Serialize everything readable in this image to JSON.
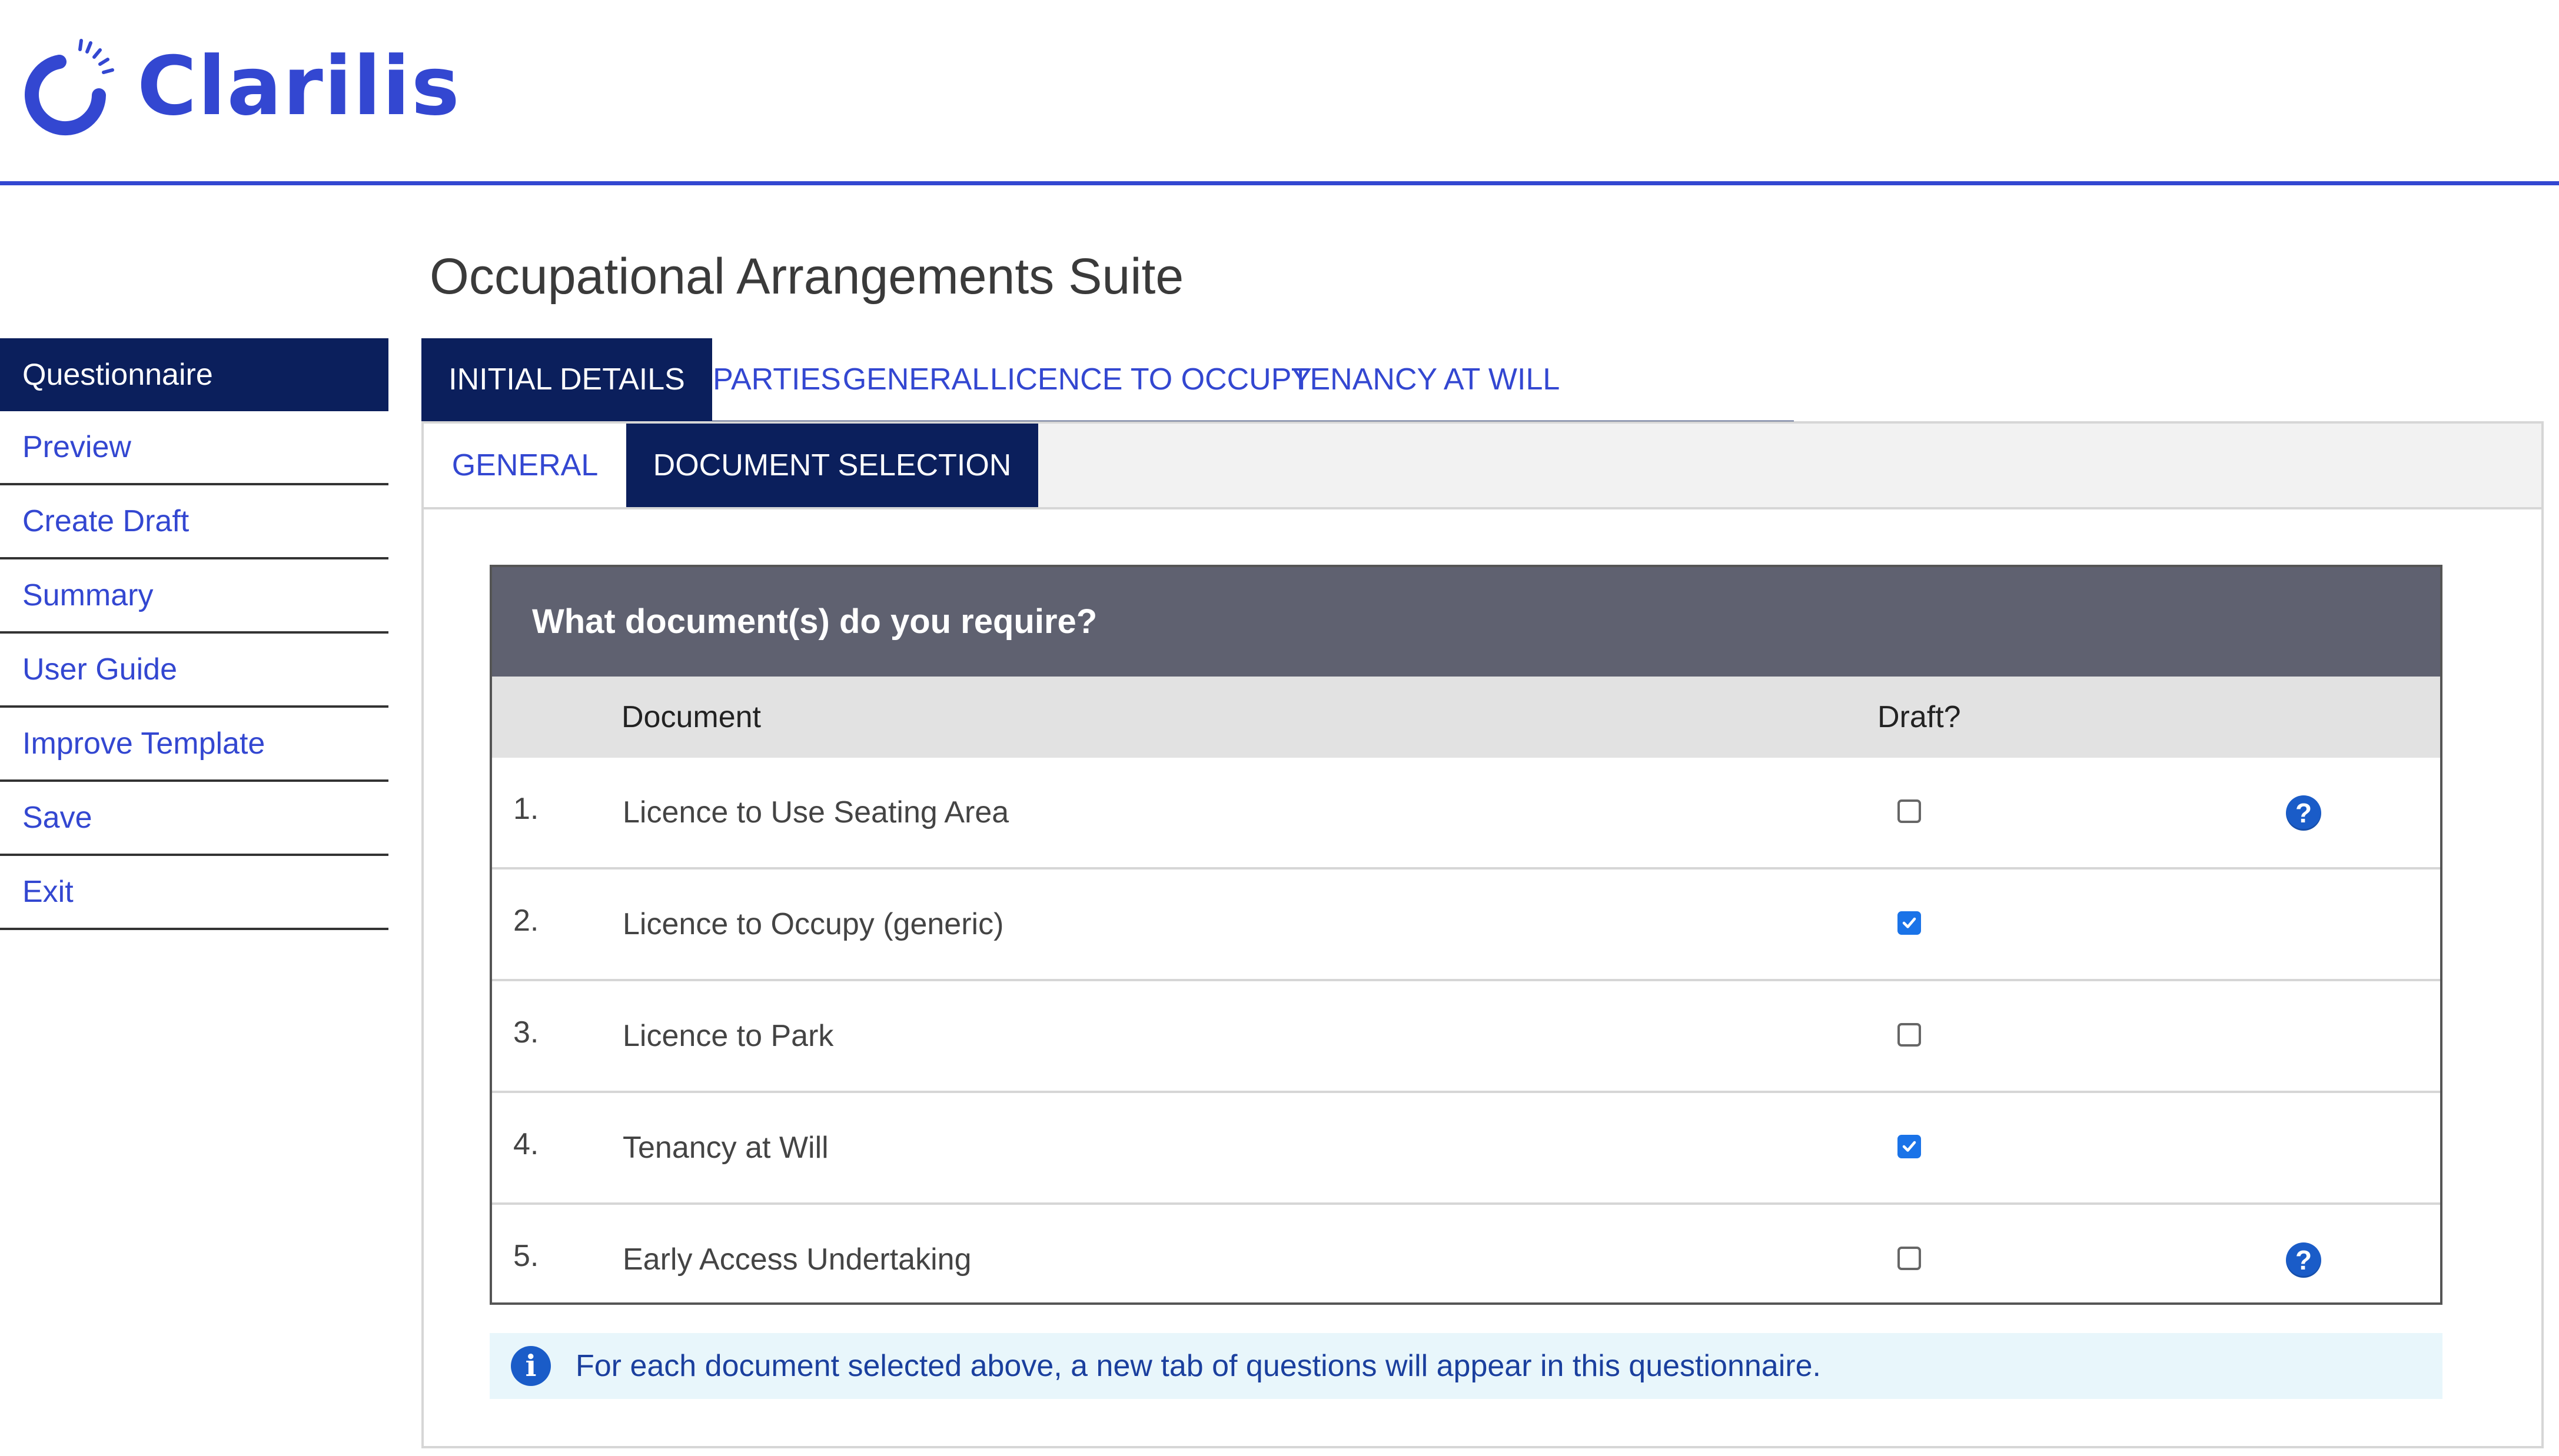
{
  "app": {
    "brand": "Clarilis",
    "brand_color": "#3347d1",
    "nav_active_color": "#0b1f5c"
  },
  "page_title": "Occupational Arrangements Suite",
  "sidebar": {
    "items": [
      {
        "label": "Questionnaire",
        "active": true
      },
      {
        "label": "Preview"
      },
      {
        "label": "Create Draft"
      },
      {
        "label": "Summary"
      },
      {
        "label": "User Guide"
      },
      {
        "label": "Improve Template"
      },
      {
        "label": "Save"
      },
      {
        "label": "Exit"
      }
    ]
  },
  "tabs": [
    {
      "label": "INITIAL DETAILS",
      "active": true
    },
    {
      "label": "PARTIES"
    },
    {
      "label": "GENERAL"
    },
    {
      "label": "LICENCE TO OCCUPY"
    },
    {
      "label": "TENANCY AT WILL"
    }
  ],
  "subtabs": [
    {
      "label": "GENERAL"
    },
    {
      "label": "DOCUMENT SELECTION",
      "active": true
    }
  ],
  "question": {
    "title": "What document(s) do you require?",
    "columns": {
      "document": "Document",
      "draft": "Draft?"
    },
    "rows": [
      {
        "num": "1.",
        "label": "Licence to Use Seating Area",
        "checked": false,
        "help": true,
        "help_icon": "question-circle-icon"
      },
      {
        "num": "2.",
        "label": "Licence to Occupy (generic)",
        "checked": true,
        "help": false
      },
      {
        "num": "3.",
        "label": "Licence to Park",
        "checked": false,
        "help": false
      },
      {
        "num": "4.",
        "label": "Tenancy at Will",
        "checked": true,
        "help": false
      },
      {
        "num": "5.",
        "label": "Early Access Undertaking",
        "checked": false,
        "help": true,
        "help_icon": "question-circle-icon"
      }
    ]
  },
  "info": {
    "icon": "info-circle-icon",
    "text": "For each document selected above, a new tab of questions will appear in this questionnaire."
  }
}
